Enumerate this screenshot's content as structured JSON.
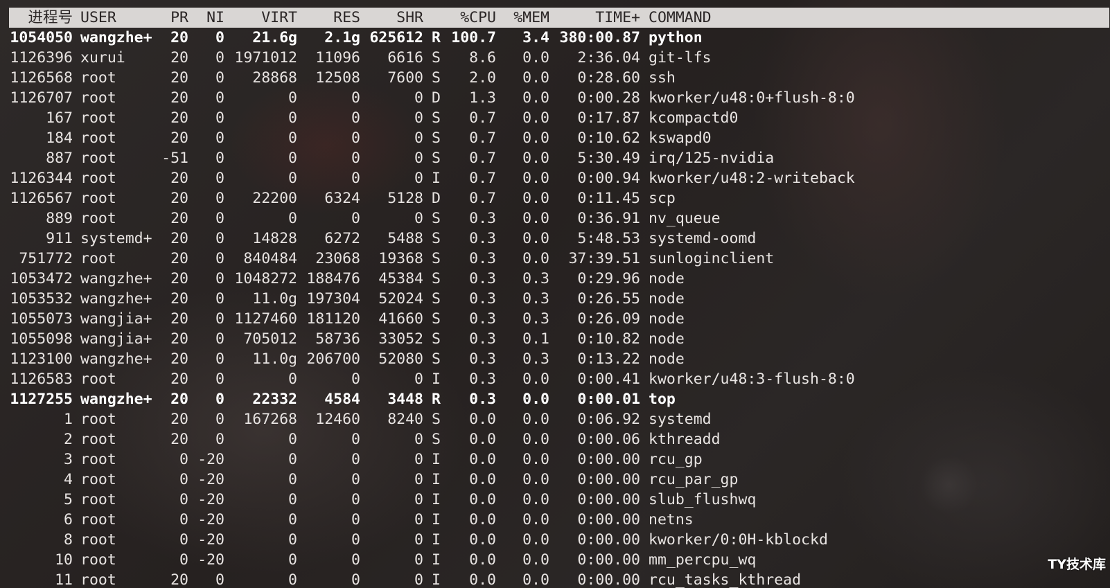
{
  "columns": {
    "pid": "进程号",
    "user": "USER",
    "pr": "PR",
    "ni": "NI",
    "virt": "VIRT",
    "res": "RES",
    "shr": "SHR",
    "s": "",
    "cpu": "%CPU",
    "mem": "%MEM",
    "time": "TIME+",
    "cmd": "COMMAND"
  },
  "processes": [
    {
      "pid": "1054050",
      "user": "wangzhe+",
      "pr": "20",
      "ni": "0",
      "virt": "21.6g",
      "res": "2.1g",
      "shr": "625612",
      "s": "R",
      "cpu": "100.7",
      "mem": "3.4",
      "time": "380:00.87",
      "cmd": "python",
      "bold": true
    },
    {
      "pid": "1126396",
      "user": "xurui",
      "pr": "20",
      "ni": "0",
      "virt": "1971012",
      "res": "11096",
      "shr": "6616",
      "s": "S",
      "cpu": "8.6",
      "mem": "0.0",
      "time": "2:36.04",
      "cmd": "git-lfs"
    },
    {
      "pid": "1126568",
      "user": "root",
      "pr": "20",
      "ni": "0",
      "virt": "28868",
      "res": "12508",
      "shr": "7600",
      "s": "S",
      "cpu": "2.0",
      "mem": "0.0",
      "time": "0:28.60",
      "cmd": "ssh"
    },
    {
      "pid": "1126707",
      "user": "root",
      "pr": "20",
      "ni": "0",
      "virt": "0",
      "res": "0",
      "shr": "0",
      "s": "D",
      "cpu": "1.3",
      "mem": "0.0",
      "time": "0:00.28",
      "cmd": "kworker/u48:0+flush-8:0"
    },
    {
      "pid": "167",
      "user": "root",
      "pr": "20",
      "ni": "0",
      "virt": "0",
      "res": "0",
      "shr": "0",
      "s": "S",
      "cpu": "0.7",
      "mem": "0.0",
      "time": "0:17.87",
      "cmd": "kcompactd0"
    },
    {
      "pid": "184",
      "user": "root",
      "pr": "20",
      "ni": "0",
      "virt": "0",
      "res": "0",
      "shr": "0",
      "s": "S",
      "cpu": "0.7",
      "mem": "0.0",
      "time": "0:10.62",
      "cmd": "kswapd0"
    },
    {
      "pid": "887",
      "user": "root",
      "pr": "-51",
      "ni": "0",
      "virt": "0",
      "res": "0",
      "shr": "0",
      "s": "S",
      "cpu": "0.7",
      "mem": "0.0",
      "time": "5:30.49",
      "cmd": "irq/125-nvidia"
    },
    {
      "pid": "1126344",
      "user": "root",
      "pr": "20",
      "ni": "0",
      "virt": "0",
      "res": "0",
      "shr": "0",
      "s": "I",
      "cpu": "0.7",
      "mem": "0.0",
      "time": "0:00.94",
      "cmd": "kworker/u48:2-writeback"
    },
    {
      "pid": "1126567",
      "user": "root",
      "pr": "20",
      "ni": "0",
      "virt": "22200",
      "res": "6324",
      "shr": "5128",
      "s": "D",
      "cpu": "0.7",
      "mem": "0.0",
      "time": "0:11.45",
      "cmd": "scp"
    },
    {
      "pid": "889",
      "user": "root",
      "pr": "20",
      "ni": "0",
      "virt": "0",
      "res": "0",
      "shr": "0",
      "s": "S",
      "cpu": "0.3",
      "mem": "0.0",
      "time": "0:36.91",
      "cmd": "nv_queue"
    },
    {
      "pid": "911",
      "user": "systemd+",
      "pr": "20",
      "ni": "0",
      "virt": "14828",
      "res": "6272",
      "shr": "5488",
      "s": "S",
      "cpu": "0.3",
      "mem": "0.0",
      "time": "5:48.53",
      "cmd": "systemd-oomd"
    },
    {
      "pid": "751772",
      "user": "root",
      "pr": "20",
      "ni": "0",
      "virt": "840484",
      "res": "23068",
      "shr": "19368",
      "s": "S",
      "cpu": "0.3",
      "mem": "0.0",
      "time": "37:39.51",
      "cmd": "sunloginclient"
    },
    {
      "pid": "1053472",
      "user": "wangzhe+",
      "pr": "20",
      "ni": "0",
      "virt": "1048272",
      "res": "188476",
      "shr": "45384",
      "s": "S",
      "cpu": "0.3",
      "mem": "0.3",
      "time": "0:29.96",
      "cmd": "node"
    },
    {
      "pid": "1053532",
      "user": "wangzhe+",
      "pr": "20",
      "ni": "0",
      "virt": "11.0g",
      "res": "197304",
      "shr": "52024",
      "s": "S",
      "cpu": "0.3",
      "mem": "0.3",
      "time": "0:26.55",
      "cmd": "node"
    },
    {
      "pid": "1055073",
      "user": "wangjia+",
      "pr": "20",
      "ni": "0",
      "virt": "1127460",
      "res": "181120",
      "shr": "41660",
      "s": "S",
      "cpu": "0.3",
      "mem": "0.3",
      "time": "0:26.09",
      "cmd": "node"
    },
    {
      "pid": "1055098",
      "user": "wangjia+",
      "pr": "20",
      "ni": "0",
      "virt": "705012",
      "res": "58736",
      "shr": "33052",
      "s": "S",
      "cpu": "0.3",
      "mem": "0.1",
      "time": "0:10.82",
      "cmd": "node"
    },
    {
      "pid": "1123100",
      "user": "wangzhe+",
      "pr": "20",
      "ni": "0",
      "virt": "11.0g",
      "res": "206700",
      "shr": "52080",
      "s": "S",
      "cpu": "0.3",
      "mem": "0.3",
      "time": "0:13.22",
      "cmd": "node"
    },
    {
      "pid": "1126583",
      "user": "root",
      "pr": "20",
      "ni": "0",
      "virt": "0",
      "res": "0",
      "shr": "0",
      "s": "I",
      "cpu": "0.3",
      "mem": "0.0",
      "time": "0:00.41",
      "cmd": "kworker/u48:3-flush-8:0"
    },
    {
      "pid": "1127255",
      "user": "wangzhe+",
      "pr": "20",
      "ni": "0",
      "virt": "22332",
      "res": "4584",
      "shr": "3448",
      "s": "R",
      "cpu": "0.3",
      "mem": "0.0",
      "time": "0:00.01",
      "cmd": "top",
      "bold": true
    },
    {
      "pid": "1",
      "user": "root",
      "pr": "20",
      "ni": "0",
      "virt": "167268",
      "res": "12460",
      "shr": "8240",
      "s": "S",
      "cpu": "0.0",
      "mem": "0.0",
      "time": "0:06.92",
      "cmd": "systemd"
    },
    {
      "pid": "2",
      "user": "root",
      "pr": "20",
      "ni": "0",
      "virt": "0",
      "res": "0",
      "shr": "0",
      "s": "S",
      "cpu": "0.0",
      "mem": "0.0",
      "time": "0:00.06",
      "cmd": "kthreadd"
    },
    {
      "pid": "3",
      "user": "root",
      "pr": "0",
      "ni": "-20",
      "virt": "0",
      "res": "0",
      "shr": "0",
      "s": "I",
      "cpu": "0.0",
      "mem": "0.0",
      "time": "0:00.00",
      "cmd": "rcu_gp"
    },
    {
      "pid": "4",
      "user": "root",
      "pr": "0",
      "ni": "-20",
      "virt": "0",
      "res": "0",
      "shr": "0",
      "s": "I",
      "cpu": "0.0",
      "mem": "0.0",
      "time": "0:00.00",
      "cmd": "rcu_par_gp"
    },
    {
      "pid": "5",
      "user": "root",
      "pr": "0",
      "ni": "-20",
      "virt": "0",
      "res": "0",
      "shr": "0",
      "s": "I",
      "cpu": "0.0",
      "mem": "0.0",
      "time": "0:00.00",
      "cmd": "slub_flushwq"
    },
    {
      "pid": "6",
      "user": "root",
      "pr": "0",
      "ni": "-20",
      "virt": "0",
      "res": "0",
      "shr": "0",
      "s": "I",
      "cpu": "0.0",
      "mem": "0.0",
      "time": "0:00.00",
      "cmd": "netns"
    },
    {
      "pid": "8",
      "user": "root",
      "pr": "0",
      "ni": "-20",
      "virt": "0",
      "res": "0",
      "shr": "0",
      "s": "I",
      "cpu": "0.0",
      "mem": "0.0",
      "time": "0:00.00",
      "cmd": "kworker/0:0H-kblockd"
    },
    {
      "pid": "10",
      "user": "root",
      "pr": "0",
      "ni": "-20",
      "virt": "0",
      "res": "0",
      "shr": "0",
      "s": "I",
      "cpu": "0.0",
      "mem": "0.0",
      "time": "0:00.00",
      "cmd": "mm_percpu_wq"
    },
    {
      "pid": "11",
      "user": "root",
      "pr": "20",
      "ni": "0",
      "virt": "0",
      "res": "0",
      "shr": "0",
      "s": "I",
      "cpu": "0.0",
      "mem": "0.0",
      "time": "0:00.00",
      "cmd": "rcu_tasks_kthread"
    }
  ],
  "watermark": "TY技术库"
}
